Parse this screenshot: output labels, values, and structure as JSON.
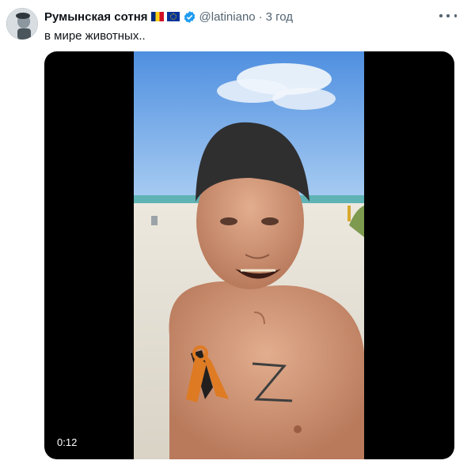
{
  "author": {
    "display_name": "Румынская сотня",
    "flags": [
      "romania-flag-icon",
      "eu-flag-icon"
    ],
    "verified_icon": "verified-badge-icon",
    "handle": "@latiniano",
    "separator": "·",
    "time": "3 год"
  },
  "tweet": {
    "text": "в мире животных.."
  },
  "media": {
    "type": "video",
    "duration": "0:12"
  },
  "icons": {
    "more": "more-horizontal-icon"
  },
  "colors": {
    "verified": "#1d9bf0",
    "secondary_text": "#536471",
    "media_background": "#000000"
  }
}
